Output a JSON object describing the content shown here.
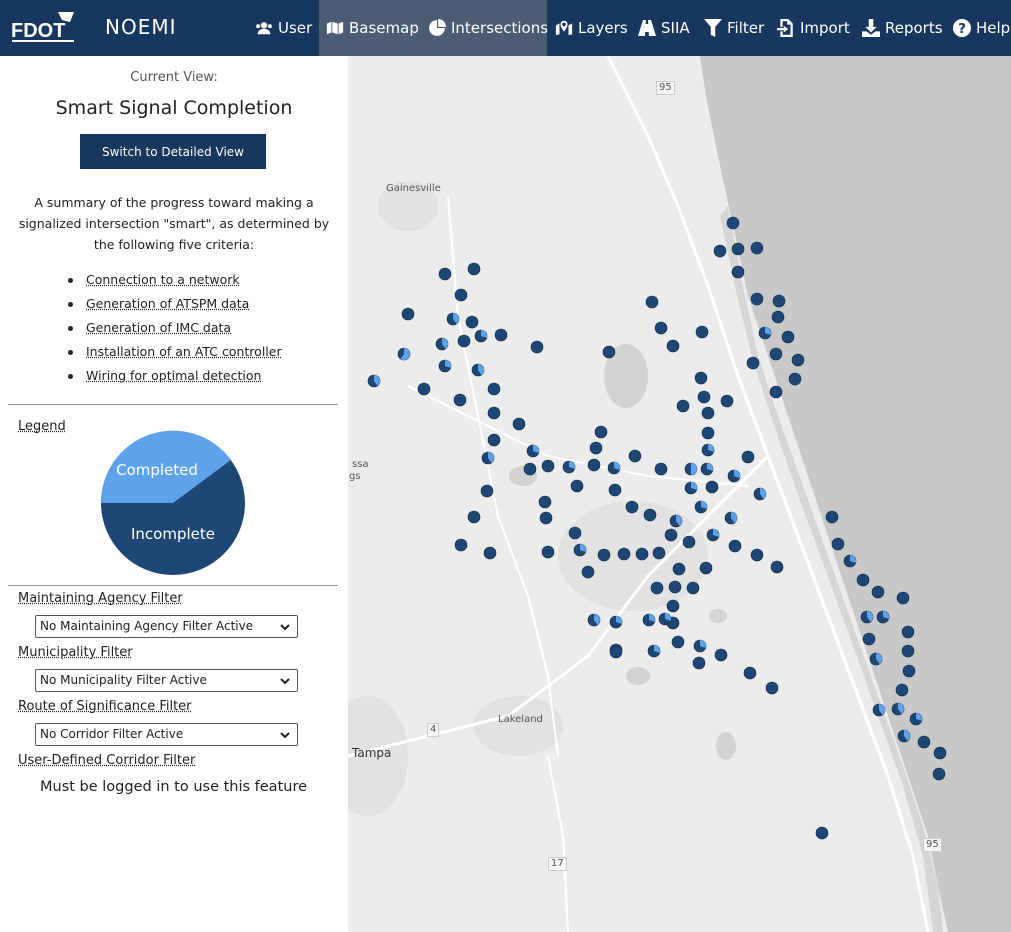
{
  "app": {
    "logo_text": "FDOT",
    "title": "NOEMI"
  },
  "nav": [
    {
      "label": "User",
      "icon": "users-icon"
    },
    {
      "label": "Basemap",
      "icon": "map-icon"
    },
    {
      "label": "Intersections",
      "icon": "pie-chart-icon"
    },
    {
      "label": "Layers",
      "icon": "map-marker-icon"
    },
    {
      "label": "SIIA",
      "icon": "road-icon"
    },
    {
      "label": "Filter",
      "icon": "filter-icon"
    },
    {
      "label": "Import",
      "icon": "import-icon"
    },
    {
      "label": "Reports",
      "icon": "download-icon"
    },
    {
      "label": "Help",
      "icon": "help-icon"
    }
  ],
  "sidebar": {
    "current_view_label": "Current View:",
    "current_view_title": "Smart Signal Completion",
    "switch_button": "Switch to Detailed View",
    "summary": "A summary of the progress toward making a signalized intersection \"smart\", as determined by the following five criteria:",
    "criteria": [
      "Connection to a network",
      "Generation of ATSPM data",
      "Generation of IMC data",
      "Installation of an ATC controller",
      "Wiring for optimal detection"
    ],
    "legend": {
      "title": "Legend",
      "completed_label": "Completed",
      "incomplete_label": "Incomplete",
      "completed_color": "#5ea3ea",
      "incomplete_color": "#1f4775"
    },
    "filters": {
      "maintaining_agency": {
        "label": "Maintaining Agency Filter",
        "value": "No Maintaining Agency Filter Active"
      },
      "municipality": {
        "label": "Municipality Filter",
        "value": "No Municipality Filter Active"
      },
      "route": {
        "label": "Route of Significance Filter",
        "value": "No Corridor Filter Active"
      },
      "user_corridor": {
        "label": "User-Defined Corridor Filter",
        "message": "Must be logged in to use this feature"
      }
    }
  },
  "map": {
    "place_labels": [
      "Gainesville",
      "Lakeland",
      "Tampa",
      "ssa",
      "gs"
    ],
    "shields": [
      "95",
      "95",
      "4",
      "17"
    ],
    "colors": {
      "land": "#ececec",
      "water": "#d3d3d3",
      "ocean": "#c8c8c8",
      "road": "#ffffff"
    }
  }
}
